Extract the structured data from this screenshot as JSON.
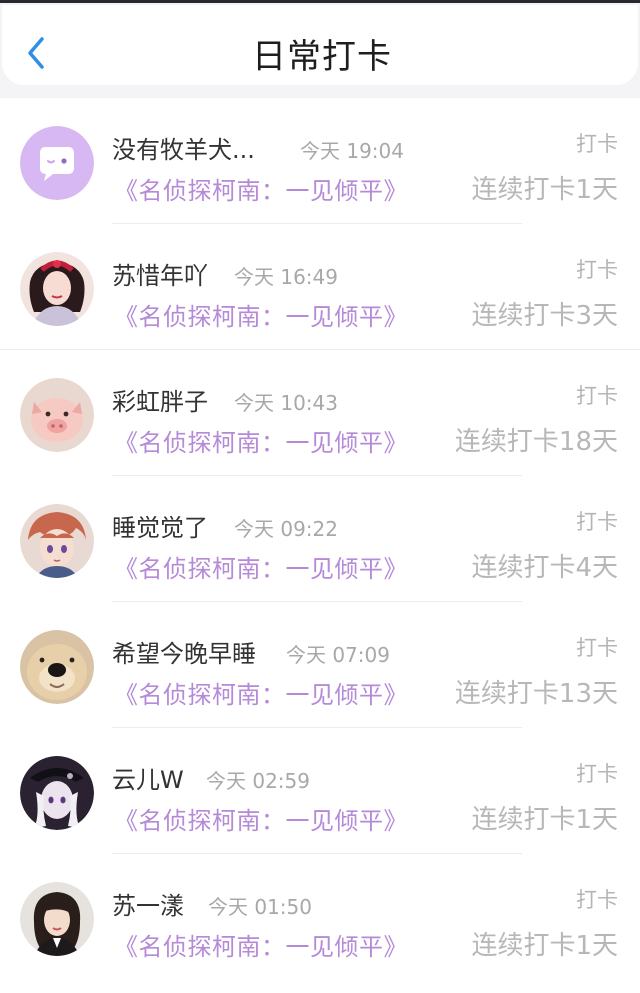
{
  "header": {
    "title": "日常打卡"
  },
  "rows": [
    {
      "name": "没有牧羊犬...",
      "time": "今天 19:04",
      "tag": "打卡",
      "subject": "《名侦探柯南：一见倾平》",
      "streak": "连续打卡1天",
      "avatar": "default-chat-avatar"
    },
    {
      "name": "苏惜年吖",
      "time": "今天 16:49",
      "tag": "打卡",
      "subject": "《名侦探柯南：一见倾平》",
      "streak": "连续打卡3天",
      "avatar": "user-photo-avatar"
    },
    {
      "name": "彩虹胖子",
      "time": "今天 10:43",
      "tag": "打卡",
      "subject": "《名侦探柯南：一见倾平》",
      "streak": "连续打卡18天",
      "avatar": "pig-avatar"
    },
    {
      "name": "睡觉觉了",
      "time": "今天 09:22",
      "tag": "打卡",
      "subject": "《名侦探柯南：一见倾平》",
      "streak": "连续打卡4天",
      "avatar": "anime-avatar"
    },
    {
      "name": "希望今晚早睡",
      "time": "今天 07:09",
      "tag": "打卡",
      "subject": "《名侦探柯南：一见倾平》",
      "streak": "连续打卡13天",
      "avatar": "dog-avatar"
    },
    {
      "name": "云儿W",
      "time": "今天 02:59",
      "tag": "打卡",
      "subject": "《名侦探柯南：一见倾平》",
      "streak": "连续打卡1天",
      "avatar": "anime-dark-avatar"
    },
    {
      "name": "苏一漾",
      "time": "今天 01:50",
      "tag": "打卡",
      "subject": "《名侦探柯南：一见倾平》",
      "streak": "连续打卡1天",
      "avatar": "user-photo-avatar"
    }
  ],
  "colors": {
    "accent": "#2f8fe6",
    "subject": "#b58ad8",
    "muted": "#b7b7b7"
  }
}
